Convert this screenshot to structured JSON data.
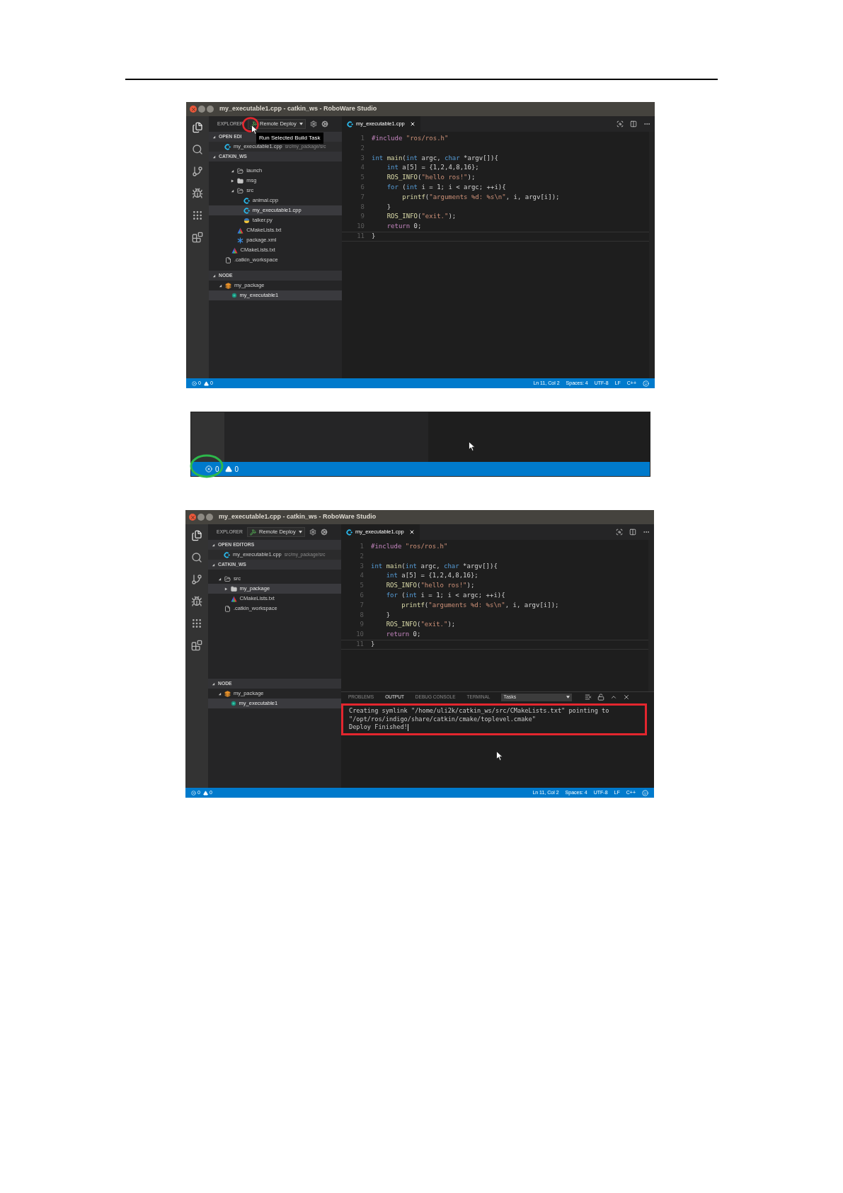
{
  "screenshots": [
    {
      "kind": "ide",
      "title": "my_executable1.cpp - catkin_ws - RoboWare Studio",
      "explorer": "EXPLORER",
      "task": "Remote Deploy",
      "tooltip": "Run Selected Build Task",
      "open_editors": {
        "title": "OPEN EDI",
        "expanded": true,
        "items": [
          {
            "name": "my_executable1.cpp",
            "detail": "src/my_package/src",
            "kind": "cpp",
            "selected": false
          }
        ]
      },
      "workspace": {
        "title": "CATKIN_WS",
        "expanded": true,
        "items": [
          {
            "kind": "group",
            "children": [
              {
                "kind": "group",
                "children": [
                  {
                    "kind": "folder-open",
                    "name": "launch",
                    "expanded": true,
                    "selected": false
                  },
                  {
                    "kind": "folder",
                    "name": "msg",
                    "expanded": false,
                    "selected": false
                  },
                  {
                    "kind": "folder-open",
                    "name": "src",
                    "expanded": true,
                    "selected": false,
                    "children": [
                      {
                        "kind": "cpp",
                        "name": "animal.cpp",
                        "selected": false
                      },
                      {
                        "kind": "cpp",
                        "name": "my_executable1.cpp",
                        "selected": true
                      },
                      {
                        "kind": "python",
                        "name": "talker.py",
                        "selected": false
                      }
                    ]
                  },
                  {
                    "kind": "cmake",
                    "name": "CMakeLists.txt",
                    "selected": false
                  },
                  {
                    "kind": "xml",
                    "name": "package.xml",
                    "selected": false
                  }
                ]
              },
              {
                "kind": "cmake",
                "name": "CMakeLists.txt",
                "selected": false
              }
            ]
          },
          {
            "kind": "file",
            "name": ".catkin_workspace",
            "selected": false
          }
        ]
      },
      "nodes": {
        "title": "NODE",
        "expanded": true,
        "items": [
          {
            "kind": "package",
            "name": "my_package",
            "expanded": true,
            "selected": false,
            "children": [
              {
                "kind": "node",
                "name": "my_executable1",
                "selected": true
              }
            ]
          }
        ]
      },
      "tab": "my_executable1.cpp",
      "code": [
        {
          "number": "1",
          "active": false,
          "tokens": [
            {
              "text": "#include",
              "kind": "directive"
            },
            {
              "text": " \"ros/ros.h\"",
              "kind": "string"
            }
          ]
        },
        {
          "number": "2",
          "active": false
        },
        {
          "number": "3",
          "active": false,
          "tokens": [
            {
              "text": "int",
              "kind": "keyword"
            },
            {
              "text": " main",
              "kind": "function"
            },
            {
              "text": "(",
              "kind": "plain"
            },
            {
              "text": "int",
              "kind": "keyword"
            },
            {
              "text": " argc, ",
              "kind": "plain"
            },
            {
              "text": "char",
              "kind": "keyword"
            },
            {
              "text": " *argv[]){",
              "kind": "plain"
            }
          ]
        },
        {
          "number": "4",
          "active": false,
          "tokens": [
            {
              "text": "    int",
              "kind": "keyword"
            },
            {
              "text": " a[5] = {1,2,4,8,16};",
              "kind": "plain"
            }
          ]
        },
        {
          "number": "5",
          "active": false,
          "tokens": [
            {
              "text": "    ROS_INFO",
              "kind": "function"
            },
            {
              "text": "(",
              "kind": "plain"
            },
            {
              "text": "\"hello ros!\"",
              "kind": "string"
            },
            {
              "text": ");",
              "kind": "plain"
            }
          ]
        },
        {
          "number": "6",
          "active": false,
          "tokens": [
            {
              "text": "    for",
              "kind": "keyword"
            },
            {
              "text": " (",
              "kind": "plain"
            },
            {
              "text": "int",
              "kind": "keyword"
            },
            {
              "text": " i = 1; i < argc; ++i){",
              "kind": "plain"
            }
          ]
        },
        {
          "number": "7",
          "active": false,
          "tokens": [
            {
              "text": "        printf",
              "kind": "function"
            },
            {
              "text": "(",
              "kind": "plain"
            },
            {
              "text": "\"arguments %d: %s\\n\"",
              "kind": "string"
            },
            {
              "text": ", i, argv[i]);",
              "kind": "plain"
            }
          ]
        },
        {
          "number": "8",
          "active": false,
          "tokens": [
            {
              "text": "    }",
              "kind": "plain"
            }
          ]
        },
        {
          "number": "9",
          "active": false,
          "tokens": [
            {
              "text": "    ROS_INFO",
              "kind": "function"
            },
            {
              "text": "(",
              "kind": "plain"
            },
            {
              "text": "\"exit.\"",
              "kind": "string"
            },
            {
              "text": ");",
              "kind": "plain"
            }
          ]
        },
        {
          "number": "10",
          "active": false,
          "tokens": [
            {
              "text": "    return",
              "kind": "control"
            },
            {
              "text": " 0;",
              "kind": "plain"
            }
          ]
        },
        {
          "number": "11",
          "active": true,
          "tokens": [
            {
              "text": "}",
              "kind": "plain"
            }
          ]
        }
      ],
      "status": {
        "errors": "0",
        "warnings": "0",
        "items": [
          "Ln 11, Col 2",
          "Spaces: 4",
          "UTF-8",
          "LF",
          "C++"
        ]
      }
    },
    {
      "kind": "strip",
      "status": {
        "errors": "0",
        "warnings": "0"
      }
    },
    {
      "kind": "ide",
      "title": "my_executable1.cpp - catkin_ws - RoboWare Studio",
      "explorer": "EXPLORER",
      "task": "Remote Deploy",
      "open_editors": {
        "title": "OPEN EDITORS",
        "expanded": true,
        "items": [
          {
            "name": "my_executable1.cpp",
            "detail": "src/my_package/src",
            "kind": "cpp",
            "selected": false
          }
        ]
      },
      "workspace": {
        "title": "CATKIN_WS",
        "expanded": true,
        "items": [
          {
            "kind": "folder-open",
            "name": "src",
            "expanded": true,
            "selected": false,
            "children": [
              {
                "kind": "folder",
                "name": "my_package",
                "expanded": false,
                "selected": true
              },
              {
                "kind": "cmake",
                "name": "CMakeLists.txt",
                "selected": false
              }
            ]
          },
          {
            "kind": "file",
            "name": ".catkin_workspace",
            "selected": false
          }
        ]
      },
      "nodes": {
        "title": "NODE",
        "expanded": true,
        "items": [
          {
            "kind": "package",
            "name": "my_package",
            "expanded": true,
            "selected": false,
            "children": [
              {
                "kind": "node",
                "name": "my_executable1",
                "selected": true
              }
            ]
          }
        ]
      },
      "tab": "my_executable1.cpp",
      "code": [
        {
          "number": "1",
          "active": false,
          "tokens": [
            {
              "text": "#include",
              "kind": "directive"
            },
            {
              "text": " \"ros/ros.h\"",
              "kind": "string"
            }
          ]
        },
        {
          "number": "2",
          "active": false
        },
        {
          "number": "3",
          "active": false,
          "tokens": [
            {
              "text": "int",
              "kind": "keyword"
            },
            {
              "text": " main",
              "kind": "function"
            },
            {
              "text": "(",
              "kind": "plain"
            },
            {
              "text": "int",
              "kind": "keyword"
            },
            {
              "text": " argc, ",
              "kind": "plain"
            },
            {
              "text": "char",
              "kind": "keyword"
            },
            {
              "text": " *argv[]){",
              "kind": "plain"
            }
          ]
        },
        {
          "number": "4",
          "active": false,
          "tokens": [
            {
              "text": "    int",
              "kind": "keyword"
            },
            {
              "text": " a[5] = {1,2,4,8,16};",
              "kind": "plain"
            }
          ]
        },
        {
          "number": "5",
          "active": false,
          "tokens": [
            {
              "text": "    ROS_INFO",
              "kind": "function"
            },
            {
              "text": "(",
              "kind": "plain"
            },
            {
              "text": "\"hello ros!\"",
              "kind": "string"
            },
            {
              "text": ");",
              "kind": "plain"
            }
          ]
        },
        {
          "number": "6",
          "active": false,
          "tokens": [
            {
              "text": "    for",
              "kind": "keyword"
            },
            {
              "text": " (",
              "kind": "plain"
            },
            {
              "text": "int",
              "kind": "keyword"
            },
            {
              "text": " i = 1; i < argc; ++i){",
              "kind": "plain"
            }
          ]
        },
        {
          "number": "7",
          "active": false,
          "tokens": [
            {
              "text": "        printf",
              "kind": "function"
            },
            {
              "text": "(",
              "kind": "plain"
            },
            {
              "text": "\"arguments %d: %s\\n\"",
              "kind": "string"
            },
            {
              "text": ", i, argv[i]);",
              "kind": "plain"
            }
          ]
        },
        {
          "number": "8",
          "active": false,
          "tokens": [
            {
              "text": "    }",
              "kind": "plain"
            }
          ]
        },
        {
          "number": "9",
          "active": false,
          "tokens": [
            {
              "text": "    ROS_INFO",
              "kind": "function"
            },
            {
              "text": "(",
              "kind": "plain"
            },
            {
              "text": "\"exit.\"",
              "kind": "string"
            },
            {
              "text": ");",
              "kind": "plain"
            }
          ]
        },
        {
          "number": "10",
          "active": false,
          "tokens": [
            {
              "text": "    return",
              "kind": "control"
            },
            {
              "text": " 0;",
              "kind": "plain"
            }
          ]
        },
        {
          "number": "11",
          "active": true,
          "tokens": [
            {
              "text": "}",
              "kind": "plain"
            }
          ]
        }
      ],
      "panel": {
        "tabs": [
          {
            "label": "PROBLEMS",
            "selected": false
          },
          {
            "label": "OUTPUT",
            "selected": true
          },
          {
            "label": "DEBUG CONSOLE",
            "selected": false
          },
          {
            "label": "TERMINAL",
            "selected": false
          }
        ],
        "dropdown": "Tasks",
        "lines": [
          "Creating symlink \"/home/uli2k/catkin_ws/src/CMakeLists.txt\" pointing to",
          "\"/opt/ros/indigo/share/catkin/cmake/toplevel.cmake\"",
          "Deploy Finished!"
        ],
        "text_cursor": true
      },
      "status": {
        "errors": "0",
        "warnings": "0",
        "items": [
          "Ln 11, Col 2",
          "Spaces: 4",
          "UTF-8",
          "LF",
          "C++"
        ]
      }
    }
  ]
}
